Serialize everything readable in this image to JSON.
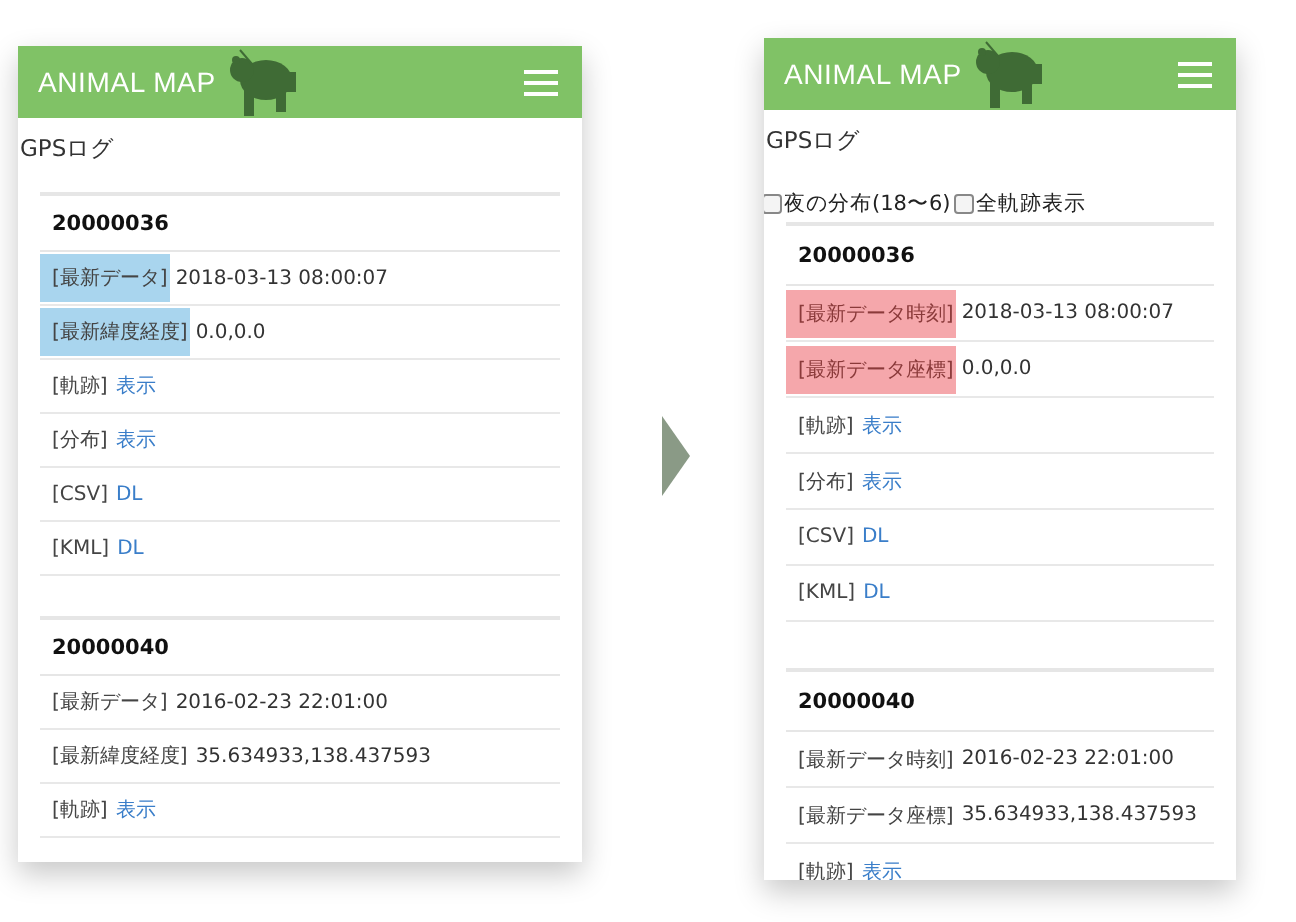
{
  "screens": [
    {
      "app_title": "ANIMAL MAP",
      "page_title": "GPSログ",
      "devices": [
        {
          "id": "20000036",
          "rows": [
            {
              "kind": "info",
              "label": "[最新データ]",
              "value": "2018-03-13 08:00:07",
              "color": "#a9d5ee"
            },
            {
              "kind": "info",
              "label": "[最新緯度経度]",
              "value": "0.0,0.0",
              "color": "#a9d5ee"
            },
            {
              "kind": "link",
              "label": "[軌跡]",
              "link": "表示"
            },
            {
              "kind": "link",
              "label": "[分布]",
              "link": "表示"
            },
            {
              "kind": "link",
              "label": "[CSV]",
              "link": "DL"
            },
            {
              "kind": "link",
              "label": "[KML]",
              "link": "DL"
            }
          ]
        },
        {
          "id": "20000040",
          "rows": [
            {
              "kind": "info",
              "label": "[最新データ]",
              "value": "2016-02-23 22:01:00"
            },
            {
              "kind": "info",
              "label": "[最新緯度経度]",
              "value": "35.634933,138.437593"
            },
            {
              "kind": "link",
              "label": "[軌跡]",
              "link": "表示"
            }
          ]
        }
      ]
    },
    {
      "app_title": "ANIMAL MAP",
      "page_title": "GPSログ",
      "filters": [
        {
          "label": "夜の分布(18〜6)",
          "checked": false
        },
        {
          "label": "全軌跡表示",
          "checked": false
        }
      ],
      "devices": [
        {
          "id": "20000036",
          "rows": [
            {
              "kind": "info",
              "label": "[最新データ時刻]",
              "value": "2018-03-13 08:00:07",
              "color": "#f5a7ab"
            },
            {
              "kind": "info",
              "label": "[最新データ座標]",
              "value": "0.0,0.0",
              "color": "#f5a7ab"
            },
            {
              "kind": "link",
              "label": "[軌跡]",
              "link": "表示"
            },
            {
              "kind": "link",
              "label": "[分布]",
              "link": "表示"
            },
            {
              "kind": "link",
              "label": "[CSV]",
              "link": "DL"
            },
            {
              "kind": "link",
              "label": "[KML]",
              "link": "DL"
            }
          ]
        },
        {
          "id": "20000040",
          "rows": [
            {
              "kind": "info",
              "label": "[最新データ時刻]",
              "value": "2016-02-23 22:01:00"
            },
            {
              "kind": "info",
              "label": "[最新データ座標]",
              "value": "35.634933,138.437593"
            },
            {
              "kind": "link",
              "label": "[軌跡]",
              "link": "表示"
            }
          ]
        }
      ]
    }
  ]
}
